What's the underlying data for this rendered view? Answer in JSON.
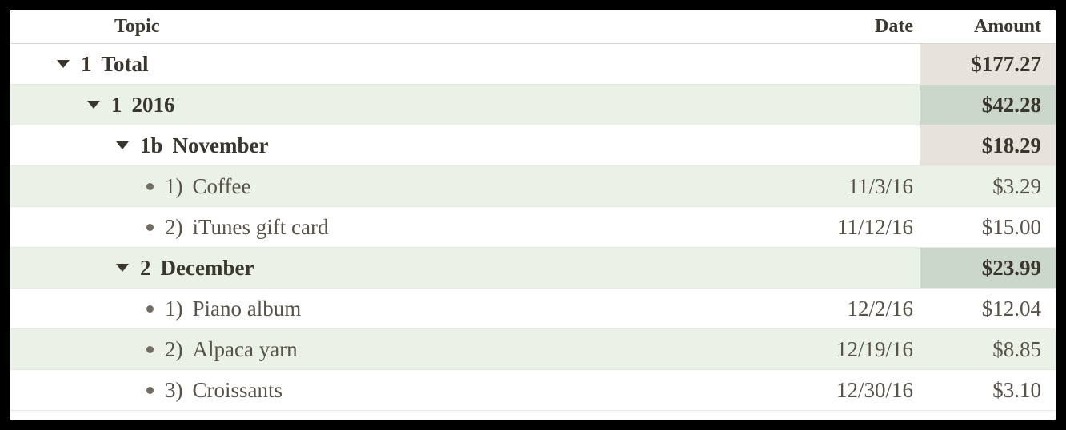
{
  "headers": {
    "topic": "Topic",
    "date": "Date",
    "amount": "Amount"
  },
  "rows": {
    "total": {
      "num": "1",
      "label": "Total",
      "amount": "$177.27"
    },
    "year2016": {
      "num": "1",
      "label": "2016",
      "amount": "$42.28"
    },
    "november": {
      "num": "1b",
      "label": "November",
      "amount": "$18.29"
    },
    "nov_1": {
      "num": "1)",
      "label": "Coffee",
      "date": "11/3/16",
      "amount": "$3.29"
    },
    "nov_2": {
      "num": "2)",
      "label": "iTunes gift card",
      "date": "11/12/16",
      "amount": "$15.00"
    },
    "december": {
      "num": "2",
      "label": "December",
      "amount": "$23.99"
    },
    "dec_1": {
      "num": "1)",
      "label": "Piano album",
      "date": "12/2/16",
      "amount": "$12.04"
    },
    "dec_2": {
      "num": "2)",
      "label": "Alpaca yarn",
      "date": "12/19/16",
      "amount": "$8.85"
    },
    "dec_3": {
      "num": "3)",
      "label": "Croissants",
      "date": "12/30/16",
      "amount": "$3.10"
    }
  }
}
